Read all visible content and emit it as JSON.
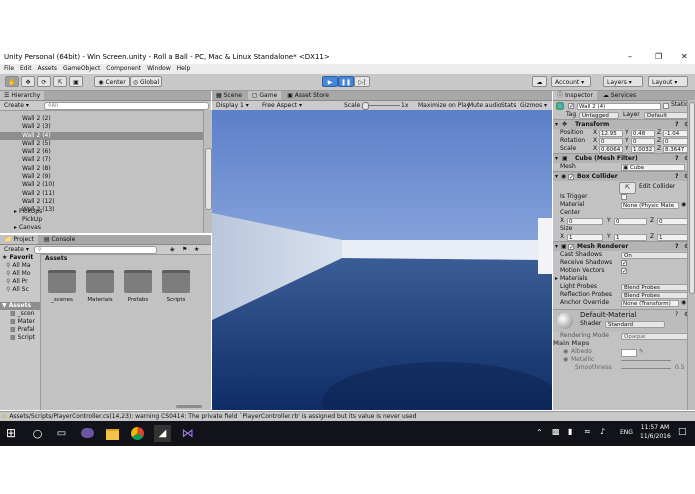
{
  "window": {
    "title": "Unity Personal (64bit) - Win Screen.unity - Roll a Ball - PC, Mac & Linux Standalone* <DX11>"
  },
  "menu": [
    "File",
    "Edit",
    "Assets",
    "GameObject",
    "Component",
    "Window",
    "Help"
  ],
  "toolbar": {
    "pivot_label": "Center",
    "space_label": "Global",
    "account_label": "Account",
    "layers_label": "Layers",
    "layout_label": "Layout"
  },
  "hierarchy": {
    "tab": "Hierarchy",
    "create_label": "Create",
    "search_placeholder": "All",
    "items": [
      {
        "label": "Wall 2 (2)",
        "selected": false
      },
      {
        "label": "Wall 2 (3)",
        "selected": false
      },
      {
        "label": "Wall 2 (4)",
        "selected": true
      },
      {
        "label": "Wall 2 (5)",
        "selected": false
      },
      {
        "label": "Wall 2 (6)",
        "selected": false
      },
      {
        "label": "Wall 2 (7)",
        "selected": false
      },
      {
        "label": "Wall 2 (8)",
        "selected": false
      },
      {
        "label": "Wall 2 (9)",
        "selected": false
      },
      {
        "label": "Wall 2 (10)",
        "selected": false
      },
      {
        "label": "Wall 2 (11)",
        "selected": false
      },
      {
        "label": "Wall 2 (12)",
        "selected": false
      },
      {
        "label": "Wall 2 (13)",
        "selected": false
      }
    ],
    "pickups_label": "PickUps",
    "pickup_label": "PickUp",
    "canvas_label": "Canvas"
  },
  "project": {
    "tab_project": "Project",
    "tab_console": "Console",
    "create_label": "Create",
    "favorites_label": "Favorit",
    "favorite_items": [
      "All Ma",
      "All Mo",
      "All Pr",
      "All Sc"
    ],
    "assets_root": "Assets",
    "tree_items": [
      "_scen",
      "Mater",
      "Prefal",
      "Script"
    ],
    "breadcrumb": "Assets",
    "folders": [
      "_scenes",
      "Materials",
      "Prefabs",
      "Scripts"
    ]
  },
  "views": {
    "scene_tab": "Scene",
    "game_tab": "Game",
    "asset_store_tab": "Asset Store",
    "display_label": "Display 1",
    "aspect_label": "Free Aspect",
    "scale_label": "Scale",
    "scale_value": "1x",
    "maximize_label": "Maximize on Play",
    "mute_label": "Mute audio",
    "stats_label": "Stats",
    "gizmos_label": "Gizmos"
  },
  "inspector": {
    "tab": "Inspector",
    "services_tab": "Services",
    "object_name": "Wall 2 (4)",
    "static_label": "Static",
    "tag_label": "Tag",
    "tag_value": "Untagged",
    "layer_label": "Layer",
    "layer_value": "Default",
    "transform": {
      "header": "Transform",
      "position_label": "Position",
      "position": {
        "x": "12.95",
        "y": "0.48",
        "z": "-1.04"
      },
      "rotation_label": "Rotation",
      "rotation": {
        "x": "0",
        "y": "0",
        "z": "0"
      },
      "scale_label": "Scale",
      "scale": {
        "x": "0.6064",
        "y": "1.0032",
        "z": "8.3647"
      }
    },
    "mesh_filter": {
      "header": "Cube (Mesh Filter)",
      "mesh_label": "Mesh",
      "mesh_value": "Cube"
    },
    "box_collider": {
      "header": "Box Collider",
      "edit_label": "Edit Collider",
      "trigger_label": "Is Trigger",
      "material_label": "Material",
      "material_value": "None (Physic Mate",
      "center_label": "Center",
      "center": {
        "x": "0",
        "y": "0",
        "z": "0"
      },
      "size_label": "Size",
      "size": {
        "x": "1",
        "y": "1",
        "z": "1"
      }
    },
    "mesh_renderer": {
      "header": "Mesh Renderer",
      "cast_label": "Cast Shadows",
      "cast_value": "On",
      "receive_label": "Receive Shadows",
      "motion_label": "Motion Vectors",
      "materials_label": "Materials",
      "light_probes_label": "Light Probes",
      "light_probes_value": "Blend Probes",
      "reflection_label": "Reflection Probes",
      "reflection_value": "Blend Probes",
      "anchor_label": "Anchor Override",
      "anchor_value": "None (Transform)"
    },
    "material": {
      "name": "Default-Material",
      "shader_label": "Shader",
      "shader_value": "Standard",
      "rendering_label": "Rendering Mode",
      "rendering_value": "Opaque",
      "main_maps_label": "Main Maps",
      "albedo_label": "Albedo",
      "metallic_label": "Metallic",
      "smoothness_label": "Smoothness",
      "smoothness_value": "0.5"
    }
  },
  "status_bar": {
    "message": "Assets/Scripts/PlayerController.cs(14,23): warning CS0414: The private field `PlayerController.rb' is assigned but its value is never used"
  },
  "taskbar": {
    "language": "ENG",
    "time": "11:57 AM",
    "date": "11/6/2016"
  },
  "colors": {
    "panel": "#c2c2c2",
    "selection": "#8e8e8e",
    "play_button": "#4a86d8",
    "taskbar": "#111318",
    "sky": "#6f8fd0",
    "floor": "#1d3d78"
  }
}
